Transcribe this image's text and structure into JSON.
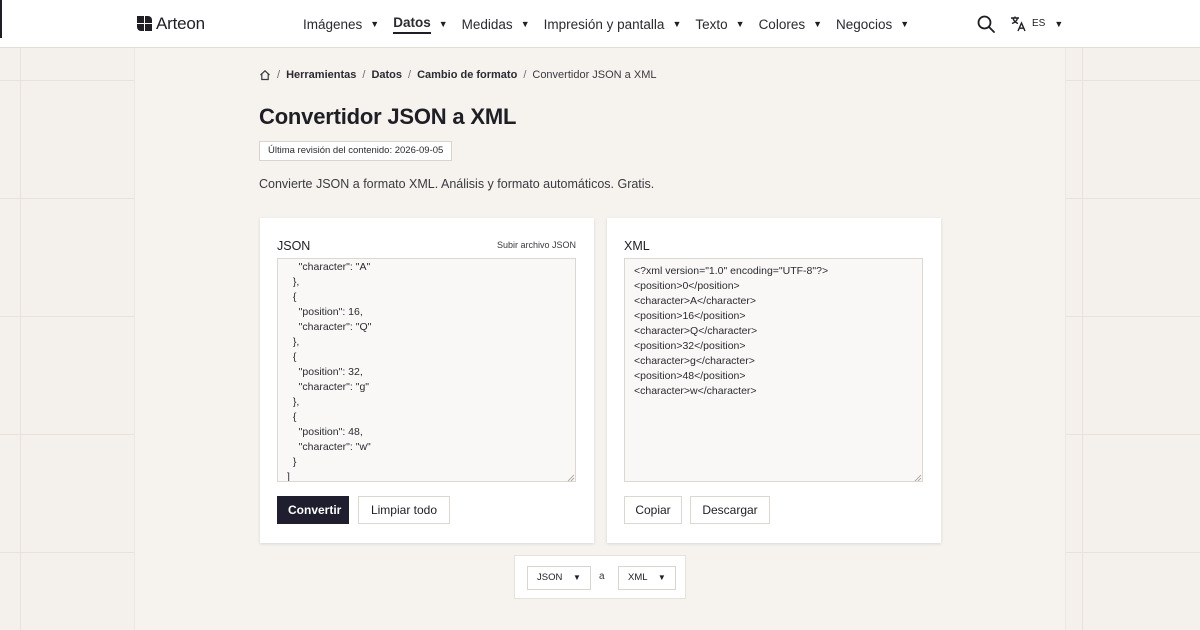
{
  "header": {
    "brand": "Arteon",
    "nav": [
      {
        "label": "Imágenes",
        "active": false
      },
      {
        "label": "Datos",
        "active": true
      },
      {
        "label": "Medidas",
        "active": false
      },
      {
        "label": "Impresión y pantalla",
        "active": false
      },
      {
        "label": "Texto",
        "active": false
      },
      {
        "label": "Colores",
        "active": false
      },
      {
        "label": "Negocios",
        "active": false
      }
    ],
    "nav_caret": "▼",
    "language": "ES",
    "icons": {
      "search": "search-icon",
      "translate": "translate-icon",
      "home": "home-icon"
    }
  },
  "breadcrumb": {
    "items": [
      "Herramientas",
      "Datos",
      "Cambio de formato"
    ],
    "current": "Convertidor JSON a XML",
    "separator": "/"
  },
  "page": {
    "title": "Convertidor JSON a XML",
    "revised": "Última revisión del contenido: 2026-09-05",
    "description": "Convierte JSON a formato XML. Análisis y formato automáticos. Gratis."
  },
  "input_panel": {
    "title": "JSON",
    "upload_link": "Subir archivo JSON",
    "content": "    \"character\": \"A\"\n  },\n  {\n    \"position\": 16,\n    \"character\": \"Q\"\n  },\n  {\n    \"position\": 32,\n    \"character\": \"g\"\n  },\n  {\n    \"position\": 48,\n    \"character\": \"w\"\n  }\n]",
    "convert_label": "Convertir",
    "clear_label": "Limpiar todo"
  },
  "output_panel": {
    "title": "XML",
    "content": "<?xml version=\"1.0\" encoding=\"UTF-8\"?>\n<position>0</position>\n<character>A</character>\n<position>16</position>\n<character>Q</character>\n<position>32</position>\n<character>g</character>\n<position>48</position>\n<character>w</character>",
    "copy_label": "Copiar",
    "download_label": "Descargar"
  },
  "format_switcher": {
    "from": "JSON",
    "connector": "a",
    "to": "XML",
    "caret": "▼"
  },
  "colors": {
    "primary_button": "#1e1e2e",
    "background": "#f4f1ed",
    "panel": "#f6f3ef"
  }
}
